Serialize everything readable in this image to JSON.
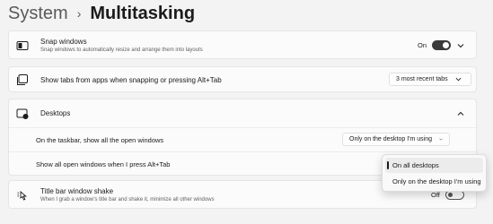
{
  "breadcrumb": {
    "parent": "System",
    "separator": "›",
    "current": "Multitasking"
  },
  "snap": {
    "title": "Snap windows",
    "description": "Snap windows to automatically resize and arrange them into layouts",
    "state_label": "On",
    "icon": "snap-windows-icon"
  },
  "tabs": {
    "title": "Show tabs from apps when snapping or pressing Alt+Tab",
    "selected": "3 most recent tabs",
    "icon": "tabs-icon"
  },
  "desktops": {
    "title": "Desktops",
    "icon": "desktops-icon",
    "taskbar_label": "On the taskbar, show all the open windows",
    "taskbar_selected": "Only on the desktop I'm using",
    "alttab_label": "Show all open windows when I press Alt+Tab"
  },
  "flyout": {
    "options": [
      "On all desktops",
      "Only on the desktop I'm using"
    ]
  },
  "shake": {
    "title": "Title bar window shake",
    "description": "When I grab a window's title bar and shake it, minimize all other windows",
    "state_label": "Off",
    "icon": "window-shake-icon"
  }
}
